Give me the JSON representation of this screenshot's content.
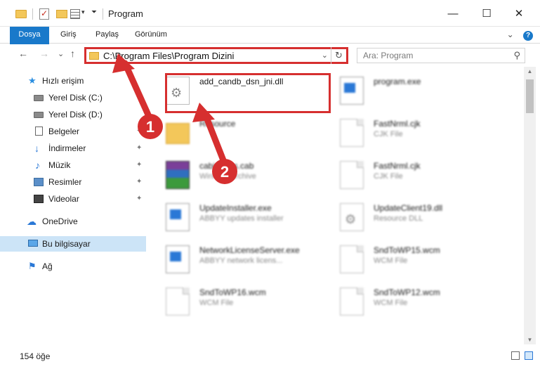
{
  "window": {
    "title": "Program",
    "controls": {
      "minimize": "—",
      "maximize": "☐",
      "close": "✕"
    }
  },
  "ribbon": {
    "tabs": [
      "Dosya",
      "Giriş",
      "Paylaş",
      "Görünüm"
    ],
    "expand_glyph": "⌄",
    "help_glyph": "?"
  },
  "nav": {
    "back": "←",
    "forward": "→",
    "recent": "⌄",
    "up": "↑",
    "address": "C:\\Program Files\\Program Dizini",
    "address_dropdown": "⌄",
    "refresh": "↻",
    "search_placeholder": "Ara: Program",
    "search_glyph": "⚲"
  },
  "sidebar": {
    "items": [
      {
        "label": "Hızlı erişim",
        "icon": "star-icon",
        "glyph": "★"
      },
      {
        "label": "Yerel Disk (C:)",
        "icon": "drive-icon"
      },
      {
        "label": "Yerel Disk (D:)",
        "icon": "drive-icon"
      },
      {
        "label": "Belgeler",
        "icon": "document-icon"
      },
      {
        "label": "İndirmeler",
        "icon": "download-icon",
        "glyph": "↓"
      },
      {
        "label": "Müzik",
        "icon": "music-icon",
        "glyph": "♪"
      },
      {
        "label": "Resimler",
        "icon": "picture-icon"
      },
      {
        "label": "Videolar",
        "icon": "video-icon"
      },
      {
        "label": "OneDrive",
        "icon": "cloud-icon",
        "glyph": "☁"
      },
      {
        "label": "Bu bilgisayar",
        "icon": "computer-icon"
      },
      {
        "label": "Ağ",
        "icon": "network-icon",
        "glyph": "⚑"
      }
    ],
    "pin_glyph": "✦"
  },
  "files": [
    {
      "name": "add_candb_dsn_jni.dll",
      "desc": "",
      "icon": "dll-file-icon"
    },
    {
      "name": "program.exe",
      "desc": "",
      "icon": "exe-file-icon"
    },
    {
      "name": "Resource",
      "desc": "",
      "icon": "folder-icon"
    },
    {
      "name": "FastNrml.cjk",
      "desc": "CJK File",
      "icon": "document-icon"
    },
    {
      "name": "cabinettes.cab",
      "desc": "WinRAR archive",
      "icon": "archive-icon"
    },
    {
      "name": "FastNrml.cjk",
      "desc": "CJK File",
      "icon": "document-icon"
    },
    {
      "name": "UpdateInstaller.exe",
      "desc": "ABBYY updates installer",
      "icon": "app-icon"
    },
    {
      "name": "UpdateClient19.dll",
      "desc": "Resource DLL",
      "icon": "dll-file-icon"
    },
    {
      "name": "NetworkLicenseServer.exe",
      "desc": "ABBYY network licens...",
      "icon": "app-icon"
    },
    {
      "name": "SndToWP15.wcm",
      "desc": "WCM File",
      "icon": "document-icon"
    },
    {
      "name": "SndToWP16.wcm",
      "desc": "WCM File",
      "icon": "document-icon"
    },
    {
      "name": "SndToWP12.wcm",
      "desc": "WCM File",
      "icon": "document-icon"
    }
  ],
  "status": {
    "count": "154 öğe"
  },
  "annotations": {
    "step1": "1",
    "step2": "2"
  },
  "colors": {
    "accent": "#1979ca",
    "highlight_red": "#d62f2f",
    "selected_bg": "#cce4f7"
  }
}
